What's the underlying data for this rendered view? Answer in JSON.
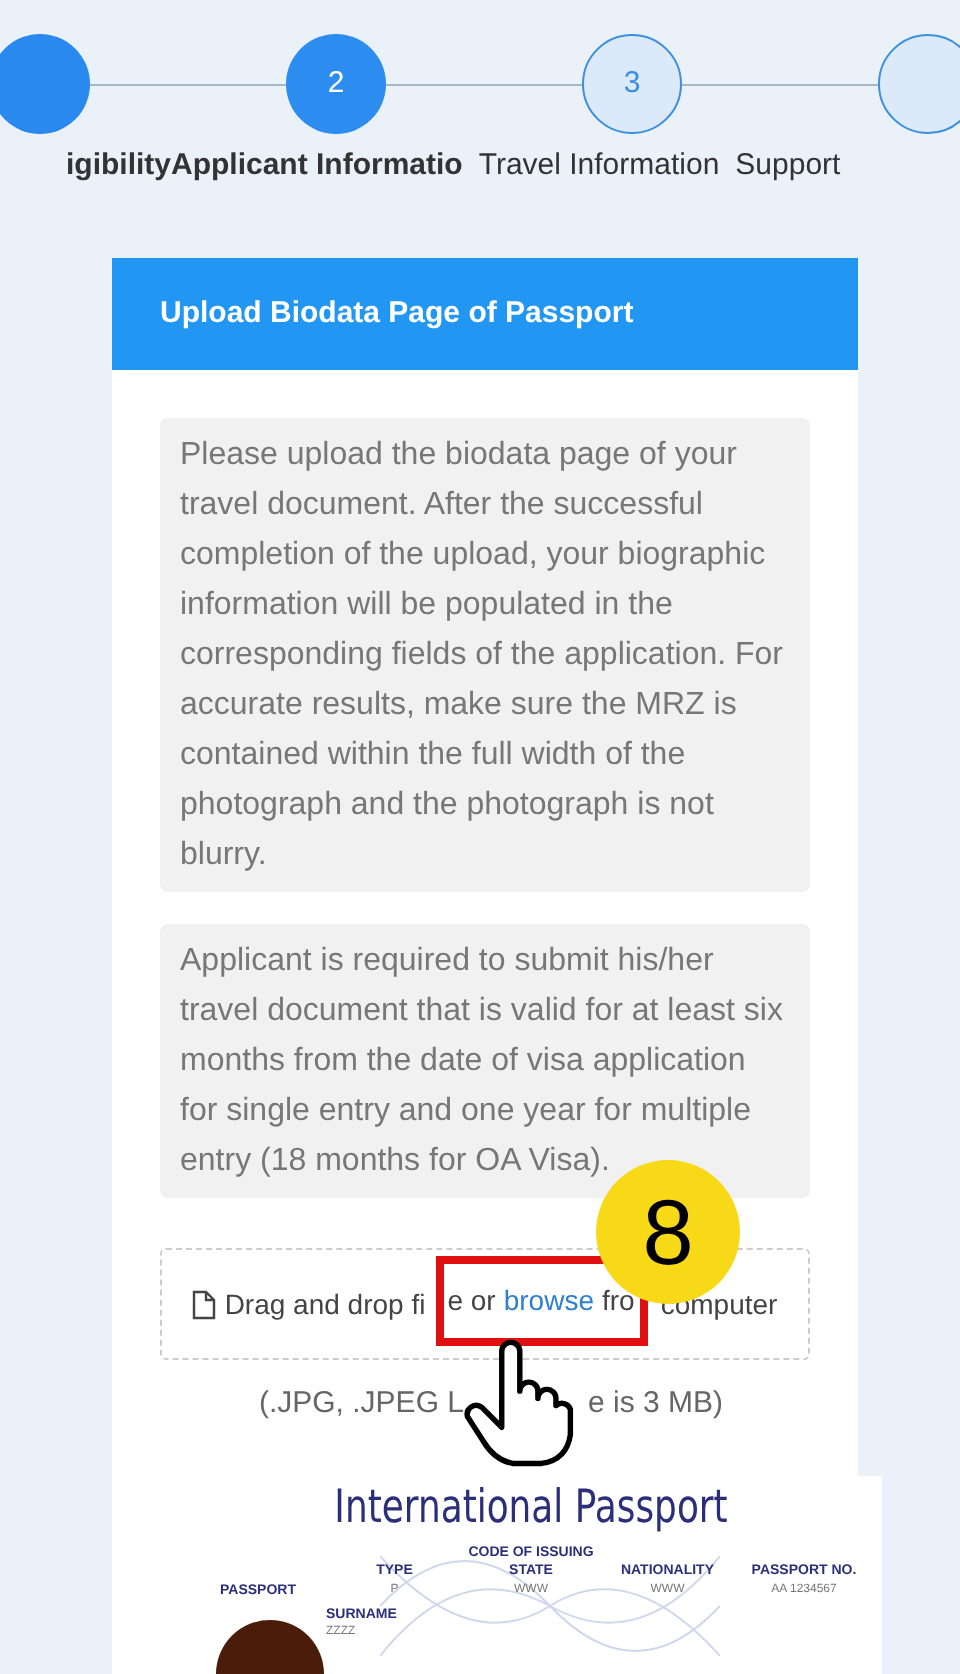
{
  "stepper": {
    "steps": [
      {
        "label": "igibility",
        "completed": true,
        "active": false
      },
      {
        "number": "2",
        "label": "Applicant Informatio",
        "completed": false,
        "active": true
      },
      {
        "number": "3",
        "label": "Travel Information",
        "completed": false,
        "active": false
      },
      {
        "label": "Support",
        "completed": false,
        "active": false
      }
    ]
  },
  "upload_card": {
    "title": "Upload Biodata Page of Passport",
    "notices": [
      "Please upload the biodata page of your travel document. After the successful completion of the upload, your biographic information will be populated in the corresponding fields of the application. For accurate results, make sure the MRZ is contained within the full width of the photograph and the photograph is not blurry.",
      "Applicant is required to submit his/her travel document that is valid for at least six months from the date of visa application for single entry and one year for multiple entry (18 months for OA Visa)."
    ],
    "dropzone": {
      "text_before": "Drag and drop fi",
      "framed_start": "e or",
      "link": "browse",
      "framed_end": "fro",
      "text_after": "computer"
    },
    "file_note": [
      "(.JPG, .JPEG L",
      "e is 3 MB)"
    ],
    "sample": {
      "title": "International Passport",
      "fields": [
        {
          "label": "PASSPORT"
        },
        {
          "label": "TYPE",
          "value": "P"
        },
        {
          "label": "CODE OF ISSUING STATE",
          "value": "WWW"
        },
        {
          "label": "NATIONALITY",
          "value": "WWW"
        },
        {
          "label": "PASSPORT NO.",
          "value": "AA 1234567"
        }
      ],
      "surname": {
        "label": "SURNAME",
        "value": "ZZZZ"
      }
    }
  },
  "annotation": {
    "step": "8"
  }
}
